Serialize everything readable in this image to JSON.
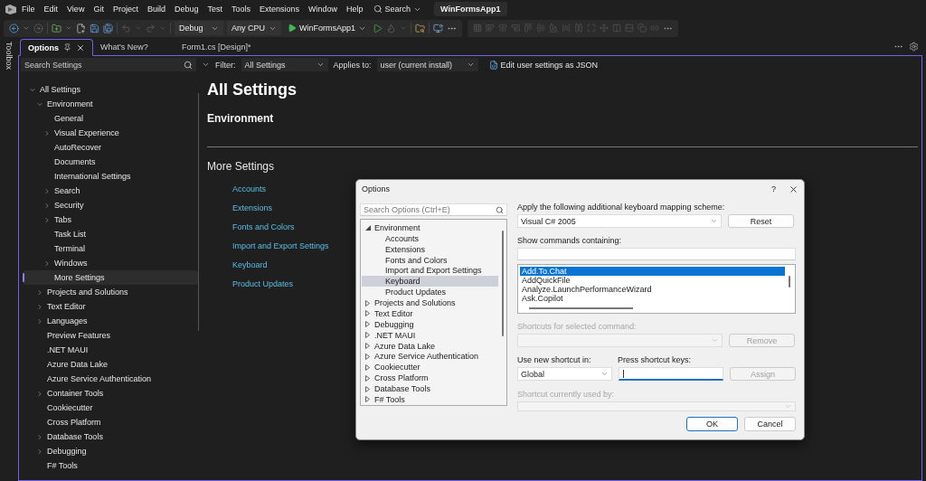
{
  "menu_bar": {
    "items": [
      "File",
      "Edit",
      "View",
      "Git",
      "Project",
      "Build",
      "Debug",
      "Test",
      "Tools",
      "Extensions",
      "Window",
      "Help"
    ],
    "search": "Search",
    "solution": "WinFormsApp1"
  },
  "toolbar": {
    "configuration": "Debug",
    "platform": "Any CPU",
    "start": "WinFormsApp1"
  },
  "toolbox_tab": "Toolbox",
  "tabs": [
    {
      "label": "Options",
      "selected": true
    },
    {
      "label": "What's New?",
      "selected": false
    },
    {
      "label": "Form1.cs [Design]*",
      "selected": false
    }
  ],
  "settings_bar": {
    "search_placeholder": "Search Settings",
    "filter_label": "Filter:",
    "filter": "All Settings",
    "applies_label": "Applies to:",
    "applies": "user (current install)",
    "json_link": "Edit user settings as JSON"
  },
  "settings_tree": [
    {
      "label": "All Settings",
      "expanded": true,
      "selected": false,
      "children": [
        {
          "label": "Environment",
          "expanded": true,
          "selected": false,
          "children": [
            {
              "label": "General",
              "selected": false
            },
            {
              "label": "Visual Experience",
              "expanded": false,
              "selected": false
            },
            {
              "label": "AutoRecover",
              "selected": false
            },
            {
              "label": "Documents",
              "selected": false
            },
            {
              "label": "International Settings",
              "selected": false
            },
            {
              "label": "Search",
              "expanded": false,
              "selected": false
            },
            {
              "label": "Security",
              "expanded": false,
              "selected": false
            },
            {
              "label": "Tabs",
              "expanded": false,
              "selected": false
            },
            {
              "label": "Task List",
              "selected": false
            },
            {
              "label": "Terminal",
              "selected": false
            },
            {
              "label": "Windows",
              "expanded": false,
              "selected": false
            },
            {
              "label": "More Settings",
              "selected": true
            }
          ]
        },
        {
          "label": "Projects and Solutions",
          "expanded": false,
          "selected": false
        },
        {
          "label": "Text Editor",
          "expanded": false,
          "selected": false
        },
        {
          "label": "Languages",
          "expanded": false,
          "selected": false
        },
        {
          "label": "Preview Features",
          "selected": false
        },
        {
          "label": ".NET MAUI",
          "selected": false
        },
        {
          "label": "Azure Data Lake",
          "selected": false
        },
        {
          "label": "Azure Service Authentication",
          "selected": false
        },
        {
          "label": "Container Tools",
          "expanded": false,
          "selected": false
        },
        {
          "label": "Cookiecutter",
          "selected": false
        },
        {
          "label": "Cross Platform",
          "selected": false
        },
        {
          "label": "Database Tools",
          "expanded": false,
          "selected": false
        },
        {
          "label": "Debugging",
          "expanded": false,
          "selected": false
        },
        {
          "label": "F# Tools",
          "selected": false
        }
      ]
    }
  ],
  "content": {
    "title": "All Settings",
    "section": "Environment",
    "more_title": "More Settings",
    "links": [
      "Accounts",
      "Extensions",
      "Fonts and Colors",
      "Import and Export Settings",
      "Keyboard",
      "Product Updates"
    ]
  },
  "dialog": {
    "title": "Options",
    "help": "?",
    "search_placeholder": "Search Options (Ctrl+E)",
    "tree": [
      {
        "label": "Environment",
        "expanded": true,
        "selected": false,
        "children": [
          {
            "label": "Accounts",
            "selected": false
          },
          {
            "label": "Extensions",
            "selected": false
          },
          {
            "label": "Fonts and Colors",
            "selected": false
          },
          {
            "label": "Import and Export Settings",
            "selected": false
          },
          {
            "label": "Keyboard",
            "selected": true
          },
          {
            "label": "Product Updates",
            "selected": false
          }
        ]
      },
      {
        "label": "Projects and Solutions",
        "expanded": false,
        "selected": false
      },
      {
        "label": "Text Editor",
        "expanded": false,
        "selected": false
      },
      {
        "label": "Debugging",
        "expanded": false,
        "selected": false
      },
      {
        "label": ".NET MAUI",
        "expanded": false,
        "selected": false
      },
      {
        "label": "Azure Data Lake",
        "expanded": false,
        "selected": false
      },
      {
        "label": "Azure Service Authentication",
        "expanded": false,
        "selected": false
      },
      {
        "label": "Cookiecutter",
        "expanded": false,
        "selected": false
      },
      {
        "label": "Cross Platform",
        "expanded": false,
        "selected": false
      },
      {
        "label": "Database Tools",
        "expanded": false,
        "selected": false
      },
      {
        "label": "F# Tools",
        "expanded": false,
        "selected": false
      }
    ],
    "scheme_label": "Apply the following additional keyboard mapping scheme:",
    "scheme": "Visual C# 2005",
    "reset": "Reset",
    "commands_label": "Show commands containing:",
    "commands": [
      {
        "label": "Add.To.Chat",
        "selected": true
      },
      {
        "label": "AddQuickFile",
        "selected": false
      },
      {
        "label": "Analyze.LaunchPerformanceWizard",
        "selected": false
      },
      {
        "label": "Ask.Copilot",
        "selected": false
      }
    ],
    "shortcuts_label": {
      "text": "Shortcuts for selected command:",
      "disabled": true
    },
    "remove": {
      "label": "Remove",
      "disabled": true
    },
    "use_in_label": "Use new shortcut in:",
    "use_in": "Global",
    "press_label": "Press shortcut keys:",
    "assign": {
      "label": "Assign",
      "disabled": true
    },
    "used_by_label": {
      "text": "Shortcut currently used by:",
      "disabled": true
    },
    "ok": "OK",
    "cancel": "Cancel"
  }
}
